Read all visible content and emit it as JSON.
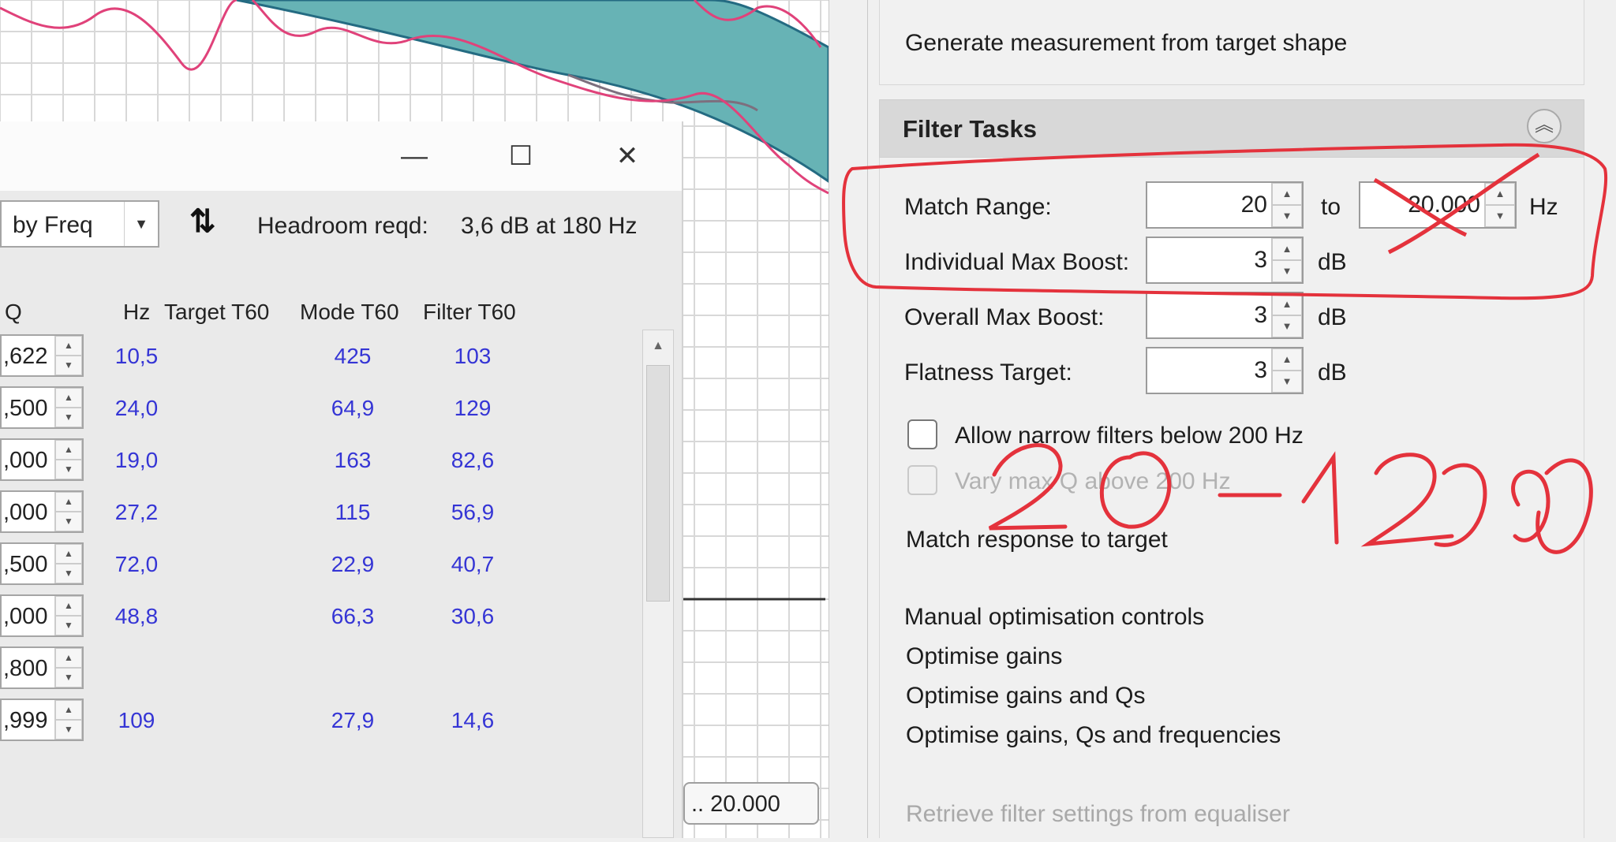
{
  "right_panel": {
    "generate_link": "Generate measurement from target shape",
    "filter_tasks_title": "Filter Tasks",
    "match_range_label": "Match Range:",
    "match_from": "20",
    "to_label": "to",
    "match_to": "20.000",
    "hz_unit": "Hz",
    "individual_max_boost_label": "Individual Max Boost:",
    "individual_max_boost": "3",
    "overall_max_boost_label": "Overall Max Boost:",
    "overall_max_boost": "3",
    "flatness_target_label": "Flatness Target:",
    "flatness_target": "3",
    "db_unit": "dB",
    "allow_narrow_label": "Allow narrow filters below 200 Hz",
    "vary_max_q_label": "Vary max Q above 200 Hz",
    "match_response": "Match response to target",
    "manual_opt": "Manual optimisation controls",
    "opt_gains": "Optimise gains",
    "opt_gains_qs": "Optimise gains and Qs",
    "opt_gains_qs_freqs": "Optimise gains, Qs and frequencies",
    "retrieve": "Retrieve filter settings from equaliser"
  },
  "dialog": {
    "minimize_glyph": "—",
    "maximize_glyph": "☐",
    "close_glyph": "✕",
    "sort_option": "by Freq",
    "headroom_label": "Headroom reqd:",
    "headroom_value": "3,6 dB at 180 Hz",
    "columns": [
      "Q",
      "Hz",
      "Target T60",
      "Mode T60",
      "Filter T60"
    ],
    "rows": [
      {
        "q": ",622",
        "hz": "10,5",
        "target": "",
        "mode": "425",
        "filter": "103"
      },
      {
        "q": ",500",
        "hz": "24,0",
        "target": "",
        "mode": "64,9",
        "filter": "129"
      },
      {
        "q": ",000",
        "hz": "19,0",
        "target": "",
        "mode": "163",
        "filter": "82,6"
      },
      {
        "q": ",000",
        "hz": "27,2",
        "target": "",
        "mode": "115",
        "filter": "56,9"
      },
      {
        "q": ",500",
        "hz": "72,0",
        "target": "",
        "mode": "22,9",
        "filter": "40,7"
      },
      {
        "q": ",000",
        "hz": "48,8",
        "target": "",
        "mode": "66,3",
        "filter": "30,6"
      },
      {
        "q": ",800",
        "hz": "",
        "target": "",
        "mode": "",
        "filter": ""
      },
      {
        "q": ",999",
        "hz": "109",
        "target": "",
        "mode": "27,9",
        "filter": "14,6"
      }
    ]
  },
  "graph": {
    "range_button": ".. 20.000"
  },
  "annotation": {
    "handwritten_text": "20-1200"
  },
  "colors": {
    "graph_fill": "#67b3b5",
    "curve_pink": "#e0427a",
    "annotation_red": "#e4323c"
  }
}
